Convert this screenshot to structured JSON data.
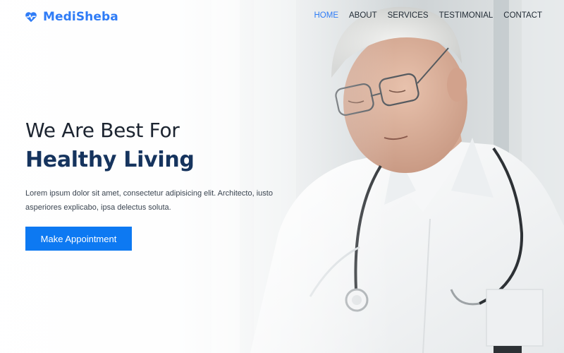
{
  "brand": {
    "name": "MediSheba",
    "icon": "heartbeat-icon",
    "color": "#2f7cf6"
  },
  "nav": {
    "items": [
      {
        "label": "HOME",
        "active": true
      },
      {
        "label": "ABOUT",
        "active": false
      },
      {
        "label": "SERVICES",
        "active": false
      },
      {
        "label": "TESTIMONIAL",
        "active": false
      },
      {
        "label": "CONTACT",
        "active": false
      }
    ],
    "active_color": "#2f7cf6"
  },
  "hero": {
    "headline_line1": "We Are Best For",
    "headline_line2": "Healthy Living",
    "description": "Lorem ipsum dolor sit amet, consectetur adipisicing elit. Architecto, iusto asperiores explicabo, ipsa delectus soluta.",
    "cta_label": "Make Appointment",
    "cta_color": "#0d79f2",
    "background_image": "elderly-doctor-with-stethoscope"
  }
}
